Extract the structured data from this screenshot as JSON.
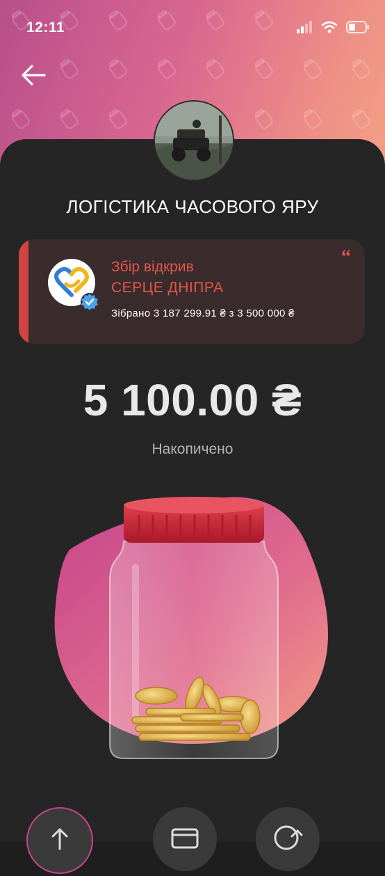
{
  "status_bar": {
    "time": "12:11"
  },
  "jar": {
    "title": "ЛОГІСТИКА ЧАСОВОГО ЯРУ",
    "amount": "5 100.00 ₴",
    "amount_label": "Накопичено"
  },
  "organizer": {
    "opened_by": "Збір відкрив",
    "name": "СЕРЦЕ ДНІПРА",
    "collected": "Зібрано 3 187 299.91 ₴ з 3 500 000 ₴"
  },
  "icons": [
    "back-arrow-icon",
    "signal-icon",
    "wifi-icon",
    "battery-icon",
    "quote-icon",
    "verified-icon",
    "upload-icon",
    "card-icon",
    "limit-icon"
  ],
  "colors": {
    "accent": "#e2574c",
    "sheet": "#262525",
    "card": "#3a2b2c",
    "gradient_start": "#b84f8c",
    "gradient_end": "#f3a184"
  }
}
